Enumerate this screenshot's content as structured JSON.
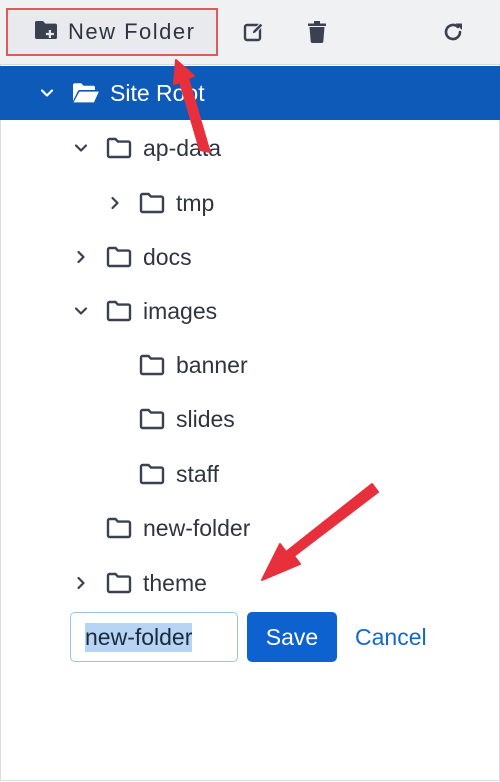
{
  "toolbar": {
    "new_folder_label": "New Folder",
    "icons": [
      "new-folder-icon",
      "edit-icon",
      "trash-icon",
      "refresh-icon"
    ]
  },
  "tree": {
    "site_root": "Site Root",
    "ap_data": "ap-data",
    "tmp": "tmp",
    "docs": "docs",
    "images": "images",
    "banner": "banner",
    "slides": "slides",
    "staff": "staff",
    "new_folder": "new-folder",
    "theme": "theme"
  },
  "edit": {
    "value": "new-folder",
    "save_label": "Save",
    "cancel_label": "Cancel"
  },
  "colors": {
    "selected_bg": "#0d5ab8",
    "primary_button": "#0e62cf",
    "annotation_red": "#e8303c"
  }
}
